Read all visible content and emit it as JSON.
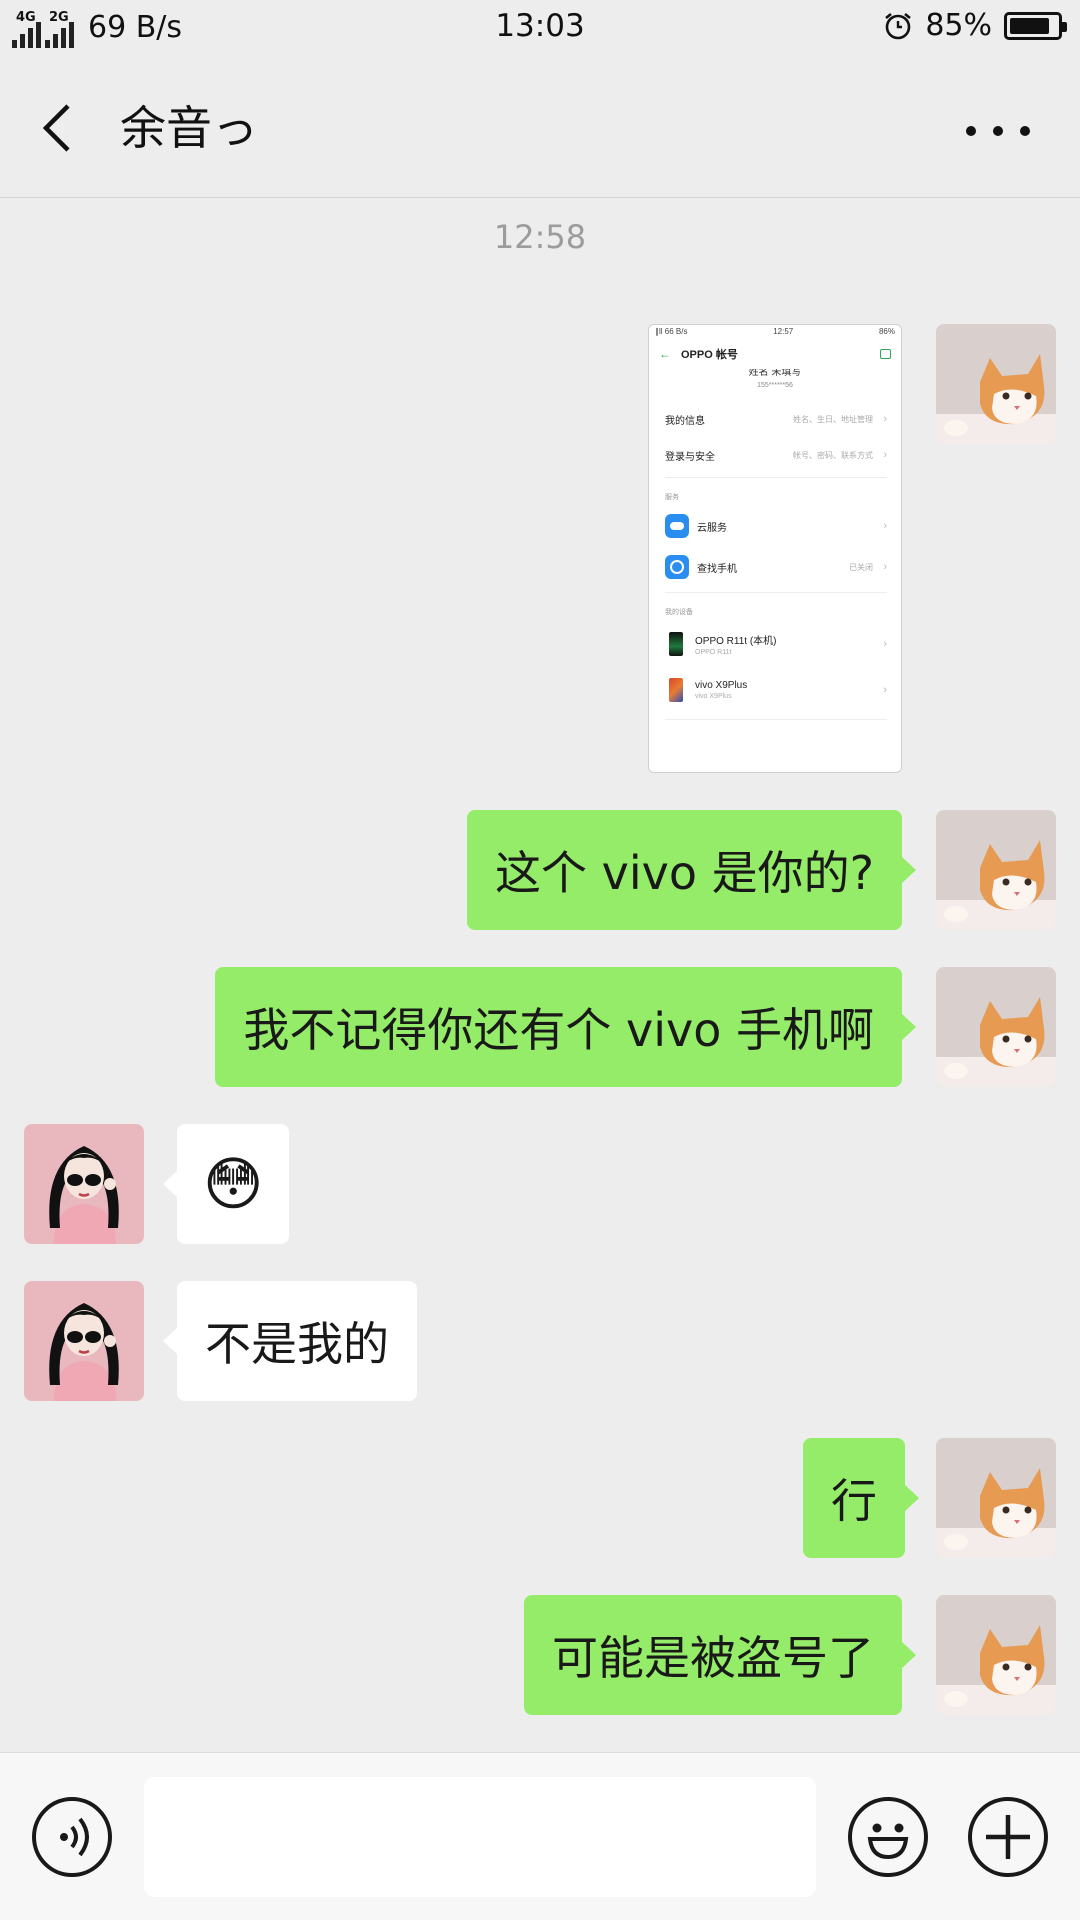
{
  "status_bar": {
    "net1": "4G",
    "net2": "2G",
    "speed": "69 B/s",
    "time": "13:03",
    "battery": "85%",
    "battery_level": 0.85
  },
  "nav": {
    "title": "余音っ"
  },
  "chat": {
    "timestamp": "12:58",
    "messages": [
      {
        "from": "me",
        "type": "image"
      },
      {
        "from": "me",
        "type": "text",
        "text": "这个 vivo 是你的?"
      },
      {
        "from": "me",
        "type": "text",
        "text": "我不记得你还有个 vivo 手机啊"
      },
      {
        "from": "other",
        "type": "emoji",
        "text": "😳"
      },
      {
        "from": "other",
        "type": "text",
        "text": "不是我的"
      },
      {
        "from": "me",
        "type": "text",
        "text": "行"
      },
      {
        "from": "me",
        "type": "text",
        "text": "可能是被盗号了"
      }
    ]
  },
  "shared_screenshot": {
    "status_left": "∥ll 66 B/s",
    "status_time": "12:57",
    "status_right": "86%",
    "header_title": "OPPO 帐号",
    "name_line": "姓名 未填写",
    "phone": "155******56",
    "rows": [
      {
        "label": "我的信息",
        "sub": "姓名、生日、地址管理"
      },
      {
        "label": "登录与安全",
        "sub": "帐号、密码、联系方式"
      }
    ],
    "services_header": "服务",
    "services": [
      {
        "label": "云服务",
        "sub": ""
      },
      {
        "label": "查找手机",
        "sub": "已关闭"
      }
    ],
    "devices_header": "我的设备",
    "devices": [
      {
        "name": "OPPO R11t (本机)",
        "model": "OPPO R11t"
      },
      {
        "name": "vivo X9Plus",
        "model": "vivo X9Plus"
      }
    ]
  },
  "input": {
    "placeholder": ""
  }
}
